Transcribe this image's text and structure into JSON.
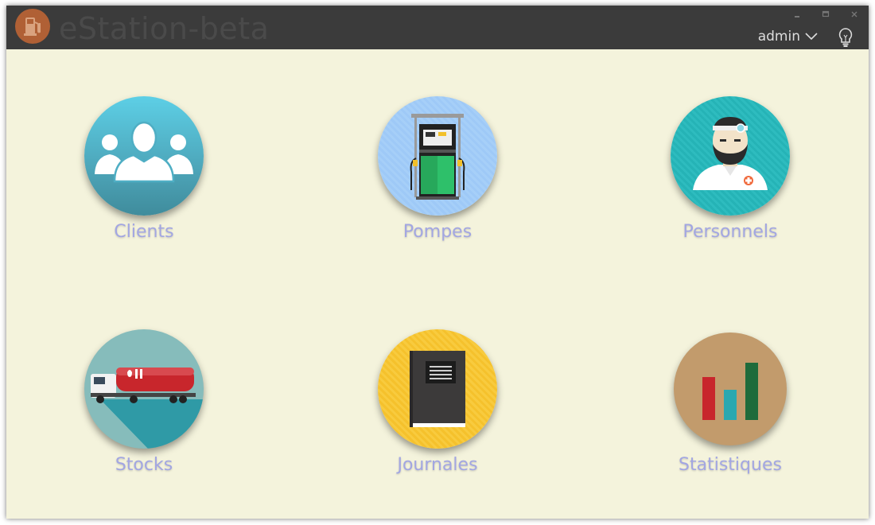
{
  "app": {
    "title": "eStation-beta",
    "logo_icon": "fuel-pump-icon"
  },
  "window_controls": [
    "minimize-icon",
    "maximize-icon",
    "close-icon"
  ],
  "user": {
    "name": "admin",
    "menu_icon": "chevron-down-icon"
  },
  "help_icon": "lightbulb-icon",
  "tiles": [
    {
      "label": "Clients",
      "icon": "users-group-icon",
      "color": "#4fb3cf"
    },
    {
      "label": "Pompes",
      "icon": "gas-pump-icon",
      "color": "#9ec9f7"
    },
    {
      "label": "Personnels",
      "icon": "doctor-staff-icon",
      "color": "#2bb5b8"
    },
    {
      "label": "Stocks",
      "icon": "tanker-truck-icon",
      "color": "#86bcbb"
    },
    {
      "label": "Journales",
      "icon": "journal-book-icon",
      "color": "#f7c733"
    },
    {
      "label": "Statistiques",
      "icon": "bar-chart-icon",
      "color": "#c29b6c"
    }
  ],
  "colors": {
    "titlebar": "#3b3b3b",
    "background": "#f4f3dc",
    "label": "#a2a6e2"
  }
}
